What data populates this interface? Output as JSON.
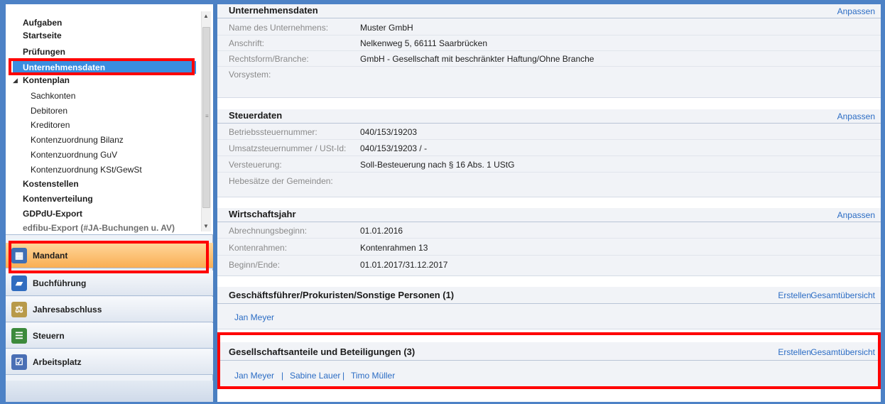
{
  "tree": {
    "items": [
      {
        "label": "Aufgaben"
      },
      {
        "label": "Startseite"
      },
      {
        "label": "Prüfungen"
      },
      {
        "label": "Unternehmensdaten"
      },
      {
        "label": "Kontenplan"
      },
      {
        "label": "Sachkonten"
      },
      {
        "label": "Debitoren"
      },
      {
        "label": "Kreditoren"
      },
      {
        "label": "Kontenzuordnung Bilanz"
      },
      {
        "label": "Kontenzuordnung GuV"
      },
      {
        "label": "Kontenzuordnung KSt/GewSt"
      },
      {
        "label": "Kostenstellen"
      },
      {
        "label": "Kontenverteilung"
      },
      {
        "label": "GDPdU-Export"
      },
      {
        "label": "edfibu-Export (#JA-Buchungen u. AV)"
      }
    ],
    "expander_glyph": "◢"
  },
  "nav": [
    {
      "label": "Mandant",
      "icon": "building-icon",
      "color": "#3f6fb5"
    },
    {
      "label": "Buchführung",
      "icon": "book-icon",
      "color": "#2f6cc0"
    },
    {
      "label": "Jahresabschluss",
      "icon": "scales-icon",
      "color": "#b89a4a"
    },
    {
      "label": "Steuern",
      "icon": "document-icon",
      "color": "#3c8a3c"
    },
    {
      "label": "Arbeitsplatz",
      "icon": "checklist-icon",
      "color": "#4a6fb5"
    }
  ],
  "sections": {
    "company": {
      "title": "Unternehmensdaten",
      "action": "Anpassen",
      "rows": [
        {
          "label": "Name des Unternehmens:",
          "value": "Muster GmbH"
        },
        {
          "label": "Anschrift:",
          "value": "Nelkenweg  5, 66111 Saarbrücken"
        },
        {
          "label": "Rechtsform/Branche:",
          "value": "GmbH - Gesellschaft mit beschränkter Haftung/Ohne Branche"
        },
        {
          "label": "Vorsystem:",
          "value": ""
        }
      ]
    },
    "tax": {
      "title": "Steuerdaten",
      "action": "Anpassen",
      "rows": [
        {
          "label": "Betriebssteuernummer:",
          "value": "040/153/19203"
        },
        {
          "label": "Umsatzsteuernummer / USt-Id:",
          "value": "040/153/19203 / -"
        },
        {
          "label": "Versteuerung:",
          "value": "Soll-Besteuerung nach § 16 Abs. 1 UStG"
        },
        {
          "label": "Hebesätze der Gemeinden:",
          "value": ""
        }
      ]
    },
    "fiscal": {
      "title": "Wirtschaftsjahr",
      "action": "Anpassen",
      "rows": [
        {
          "label": "Abrechnungsbeginn:",
          "value": "01.01.2016"
        },
        {
          "label": "Kontenrahmen:",
          "value": "Kontenrahmen 13"
        },
        {
          "label": "Beginn/Ende:",
          "value": "01.01.2017/31.12.2017"
        }
      ]
    },
    "managers": {
      "title": "Geschäftsführer/Prokuristen/Sonstige Personen (1)",
      "action_create": "Erstellen",
      "action_overview": "Gesamtübersicht",
      "people": [
        "Jan Meyer"
      ]
    },
    "shares": {
      "title": "Gesellschaftsanteile und Beteiligungen (3)",
      "action_create": "Erstellen",
      "action_overview": "Gesamtübersicht",
      "people": [
        "Jan Meyer",
        "Sabine Lauer",
        "Timo Müller"
      ],
      "separator": "|"
    }
  },
  "colors": {
    "accent_link": "#2b6cc4",
    "selection": "#3a8de0",
    "highlight_box": "#ff0000",
    "active_nav": "#f9ae53"
  }
}
